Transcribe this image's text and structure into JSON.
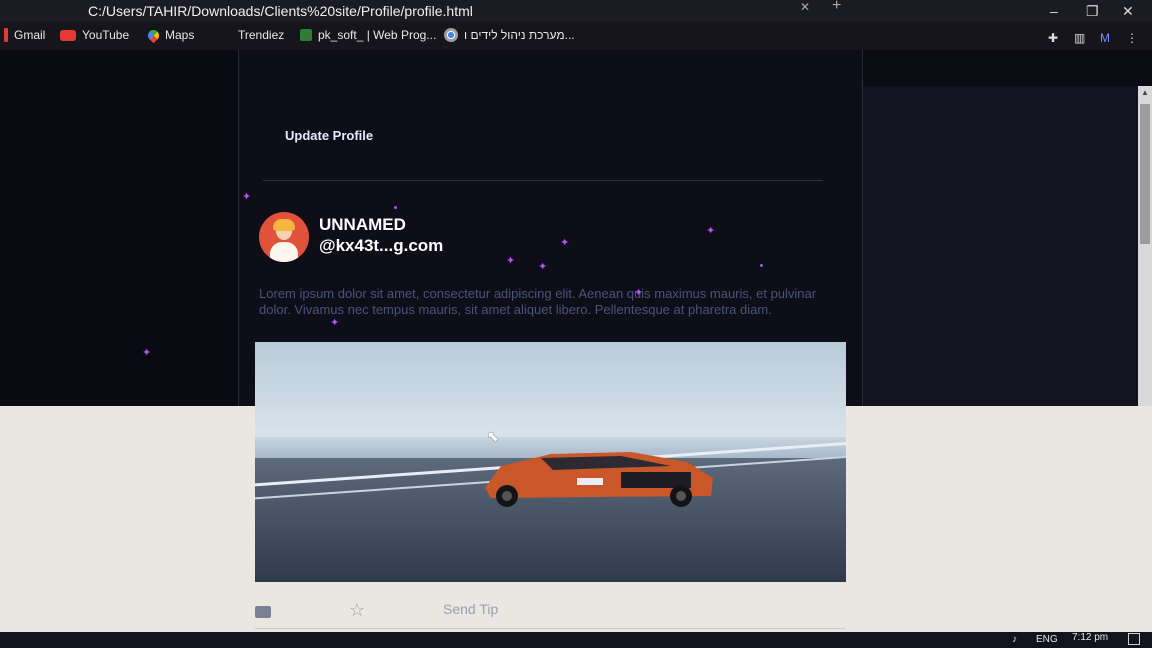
{
  "browser": {
    "address": "C:/Users/TAHIR/Downloads/Clients%20site/Profile/profile.html",
    "bookmarks": [
      {
        "label": "Gmail",
        "icon": "gmail-icon"
      },
      {
        "label": "YouTube",
        "icon": "youtube-icon"
      },
      {
        "label": "Maps",
        "icon": "maps-icon"
      },
      {
        "label": "Trendiez",
        "icon": ""
      },
      {
        "label": "pk_soft_ | Web Prog...",
        "icon": "pk-soft-icon"
      },
      {
        "label": "מערכת ניהול לידים ו...",
        "icon": "chrome-icon"
      }
    ],
    "profile_initial": "M",
    "window_controls": {
      "minimize": "–",
      "maximize": "❐",
      "close": "✕"
    }
  },
  "profile": {
    "update_button": "Update Profile",
    "name": "UNNAMED",
    "handle": "@kx43t...g.com",
    "bio": "Lorem ipsum dolor sit amet, consectetur adipiscing elit. Aenean quis maximus mauris, et pulvinar dolor. Vivamus nec tempus mauris, sit amet aliquet libero. Pellentesque at pharetra diam."
  },
  "post": {
    "send_tip": "Send Tip"
  },
  "taskbar": {
    "language": "ENG",
    "time": "7:12 pm"
  },
  "colors": {
    "accent_star": "#b455f0",
    "page_bg": "#0b0b14",
    "lower_bg": "#e9e7df"
  }
}
